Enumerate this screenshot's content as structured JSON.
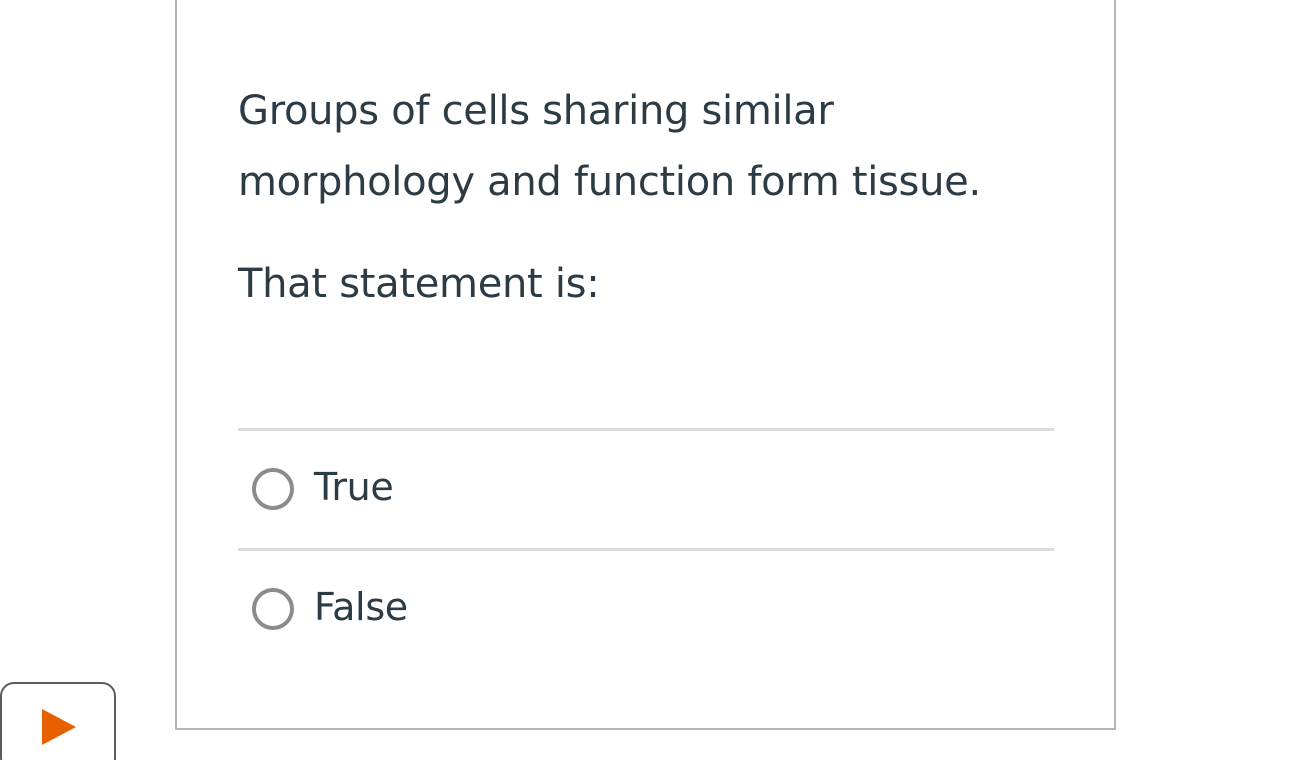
{
  "question": {
    "text": "Groups of cells sharing similar morphology and function form tissue.",
    "prompt": "That statement is:"
  },
  "answers": [
    {
      "label": "True",
      "selected": false
    },
    {
      "label": "False",
      "selected": false
    }
  ],
  "navigation": {
    "icon": "play-icon",
    "accent_color": "#e66000"
  }
}
